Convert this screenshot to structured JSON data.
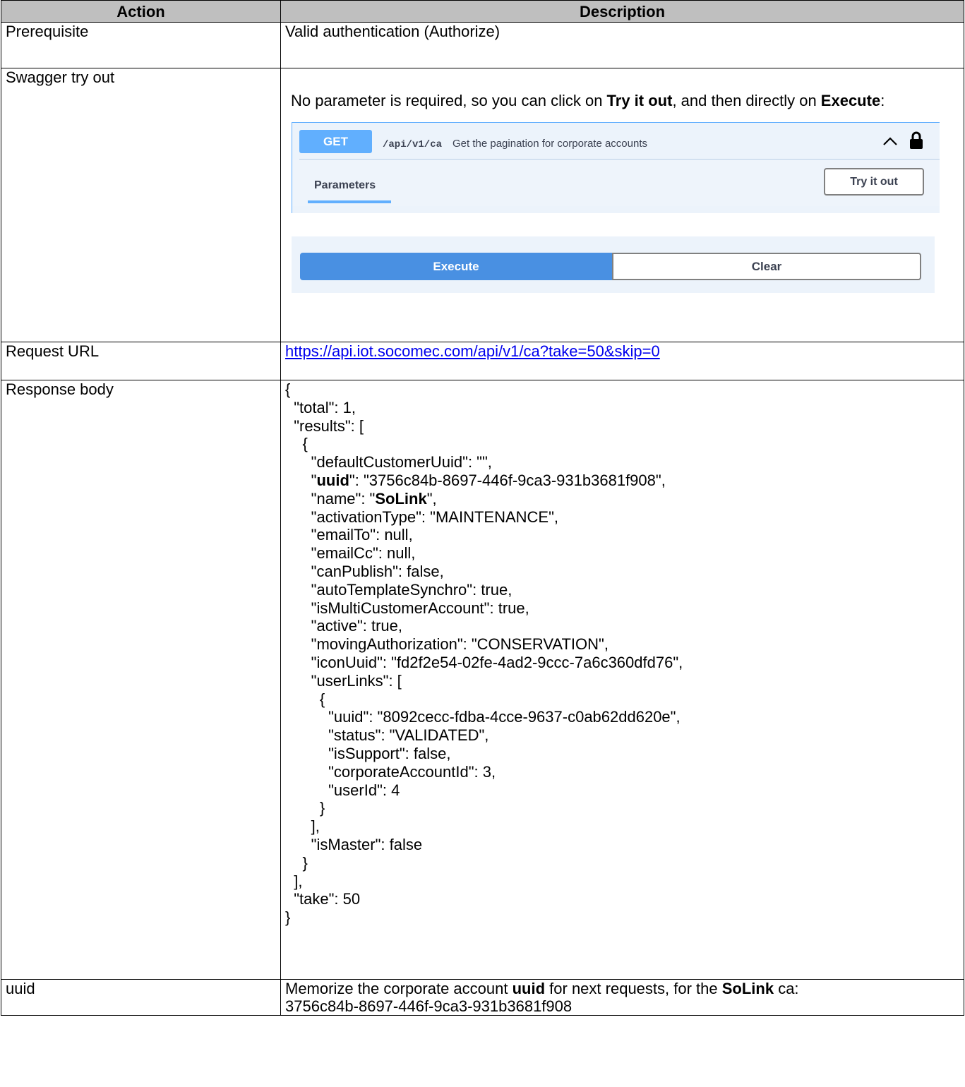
{
  "headers": {
    "action": "Action",
    "description": "Description"
  },
  "rows": {
    "prerequisite": {
      "action": "Prerequisite",
      "description": "Valid authentication (Authorize)"
    },
    "swagger": {
      "action": "Swagger try out",
      "intro_a": "No parameter is required, so you can click on ",
      "intro_b": "Try it out",
      "intro_c": ", and then directly on ",
      "intro_d": "Execute",
      "intro_e": ":",
      "widget": {
        "method": "GET",
        "path": "/api/v1/ca",
        "summary": "Get the pagination for corporate accounts",
        "tab_label": "Parameters",
        "try_label": "Try it out",
        "execute_label": "Execute",
        "clear_label": "Clear",
        "chevron_icon": "chevron-up-icon",
        "lock_icon": "lock-icon"
      }
    },
    "request_url": {
      "action": "Request URL",
      "url": "https://api.iot.socomec.com/api/v1/ca?take=50&skip=0"
    },
    "response": {
      "action": "Response body",
      "l01": "{",
      "l02": "  \"total\": 1,",
      "l03": "  \"results\": [",
      "l04": "    {",
      "l05": "      \"defaultCustomerUuid\": \"\",",
      "l06a": "      \"",
      "l06b": "uuid",
      "l06c": "\": \"3756c84b-8697-446f-9ca3-931b3681f908\",",
      "l07a": "      \"name\": \"",
      "l07b": "SoLink",
      "l07c": "\",",
      "l08": "      \"activationType\": \"MAINTENANCE\",",
      "l09": "      \"emailTo\": null,",
      "l10": "      \"emailCc\": null,",
      "l11": "      \"canPublish\": false,",
      "l12": "      \"autoTemplateSynchro\": true,",
      "l13": "      \"isMultiCustomerAccount\": true,",
      "l14": "      \"active\": true,",
      "l15": "      \"movingAuthorization\": \"CONSERVATION\",",
      "l16": "      \"iconUuid\": \"fd2f2e54-02fe-4ad2-9ccc-7a6c360dfd76\",",
      "l17": "      \"userLinks\": [",
      "l18": "        {",
      "l19": "          \"uuid\": \"8092cecc-fdba-4cce-9637-c0ab62dd620e\",",
      "l20": "          \"status\": \"VALIDATED\",",
      "l21": "          \"isSupport\": false,",
      "l22": "          \"corporateAccountId\": 3,",
      "l23": "          \"userId\": 4",
      "l24": "        }",
      "l25": "      ],",
      "l26": "      \"isMaster\": false",
      "l27": "    }",
      "l28": "  ],",
      "l29": "  \"take\": 50",
      "l30": "}"
    },
    "uuid": {
      "action": "uuid",
      "desc_a": "Memorize the corporate account ",
      "desc_b": "uuid",
      "desc_c": " for next requests, for the ",
      "desc_d": "SoLink",
      "desc_e": " ca:",
      "desc_value": "3756c84b-8697-446f-9ca3-931b3681f908"
    }
  }
}
